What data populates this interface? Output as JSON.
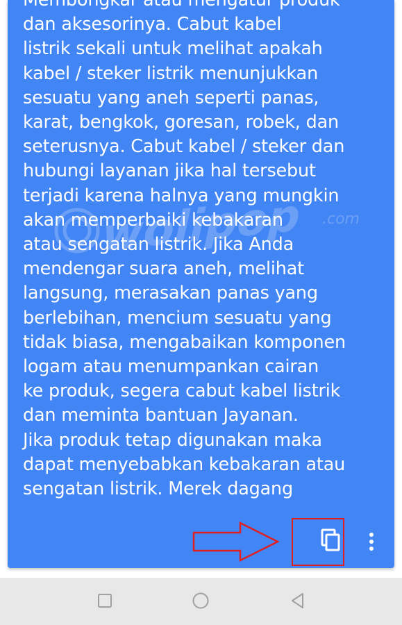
{
  "message": {
    "lines": [
      "Membongkar atau mengatur produk",
      "dan aksesorinya.  Cabut kabel",
      "listrik sekali untuk melihat apakah",
      "kabel / steker listrik menunjukkan",
      "sesuatu yang aneh seperti panas,",
      "karat, bengkok, goresan, robek, dan",
      "seterusnya.  Cabut kabel / steker dan",
      "hubungi layanan jika hal tersebut",
      "terjadi karena halnya yang mungkin",
      "akan memperbaiki kebakaran",
      "atau sengatan listrik.  Jika Anda",
      "mendengar suara aneh, melihat",
      "langsung, merasakan panas yang",
      "berlebihan, mencium sesuatu yang",
      "tidak biasa, mengabaikan komponen",
      "logam atau menumpankan cairan",
      "ke produk, segera cabut kabel listrik",
      "dan meminta bantuan Jayanan.",
      "Jika produk tetap digunakan maka",
      "dapat menyebabkan kebakaran atau",
      "sengatan listrik.  Merek dagang"
    ]
  },
  "watermark": {
    "text": "wolipop",
    "suffix": ".com"
  },
  "actions": {
    "copy_icon": "copy-icon",
    "more_icon": "more-vert-icon"
  },
  "annotation": {
    "arrow_color": "#e02020",
    "box_color": "#e02020"
  },
  "navbar": {
    "icons": [
      "recents-square-icon",
      "home-circle-icon",
      "back-triangle-icon"
    ]
  },
  "colors": {
    "card_bg": "#4285f4",
    "text": "#ffffff",
    "navbar_bg": "#e8e8e8",
    "nav_icon": "#a0a0a0"
  }
}
